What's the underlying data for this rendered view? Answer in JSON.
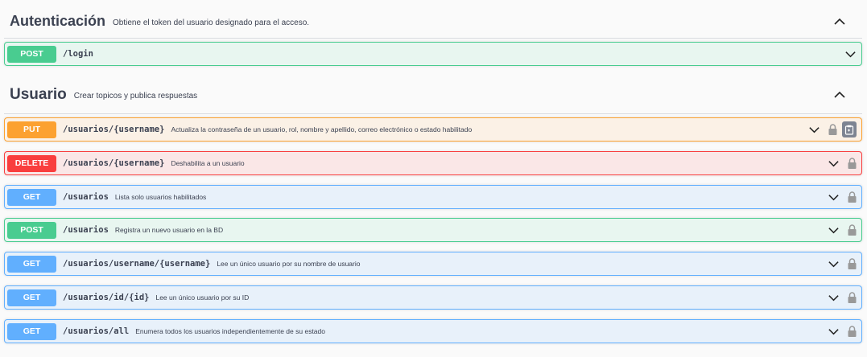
{
  "sections": [
    {
      "title": "Autenticación",
      "description": "Obtiene el token del usuario designado para el acceso.",
      "operations": [
        {
          "method": "POST",
          "path": "/login",
          "summary": ""
        }
      ]
    },
    {
      "title": "Usuario",
      "description": "Crear topicos y publica respuestas",
      "operations": [
        {
          "method": "PUT",
          "path": "/usuarios/{username}",
          "summary": "Actualiza la contraseña de un usuario, rol, nombre y apellido, correo electrónico o estado habilitado"
        },
        {
          "method": "DELETE",
          "path": "/usuarios/{username}",
          "summary": "Deshabilita a un usuario"
        },
        {
          "method": "GET",
          "path": "/usuarios",
          "summary": "Lista solo usuarios habilitados"
        },
        {
          "method": "POST",
          "path": "/usuarios",
          "summary": "Registra un nuevo usuario en la BD"
        },
        {
          "method": "GET",
          "path": "/usuarios/username/{username}",
          "summary": "Lee un único usuario por su nombre de usuario"
        },
        {
          "method": "GET",
          "path": "/usuarios/id/{id}",
          "summary": "Lee un único usuario por su ID"
        },
        {
          "method": "GET",
          "path": "/usuarios/all",
          "summary": "Enumera todos los usuarios independientemente de su estado"
        }
      ]
    }
  ],
  "colors": {
    "post": "#49cc90",
    "put": "#fca130",
    "delete": "#f93e3e",
    "get": "#61affe"
  },
  "icons": [
    "chevron-up-icon",
    "chevron-down-icon",
    "lock-icon",
    "copy-icon"
  ]
}
